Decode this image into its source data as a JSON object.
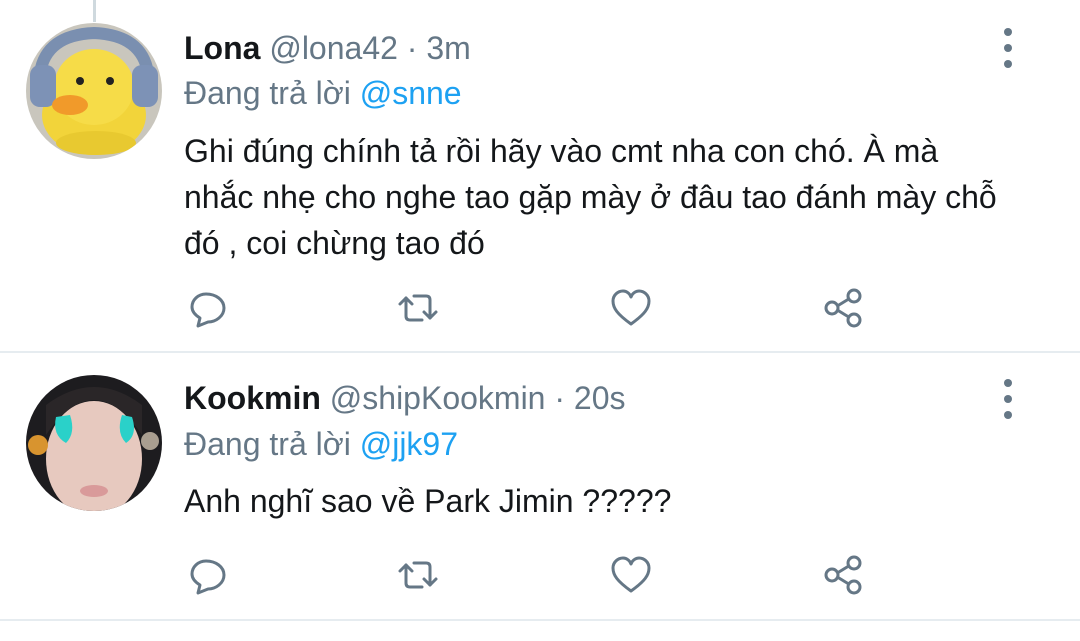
{
  "tweets": [
    {
      "name": "Lona",
      "handle": "@lona42",
      "separator": "·",
      "time": "3m",
      "reply_prefix": "Đang trả lời",
      "reply_to": "@snne",
      "text": "Ghi đúng chính tả rồi hãy vào cmt nha con chó. À mà nhắc nhẹ cho nghe tao gặp mày ở đâu tao đánh mày chỗ đó , coi chừng tao đó",
      "avatar_icon": "yellow-duck-with-headphones-avatar"
    },
    {
      "name": "Kookmin",
      "handle": "@shipKookmin",
      "separator": "·",
      "time": "20s",
      "reply_prefix": "Đang trả lời",
      "reply_to": "@jjk97",
      "text": "Anh nghĩ sao về Park Jimin ?????",
      "avatar_icon": "crying-face-photo-avatar"
    }
  ],
  "action_icons": [
    "reply-icon",
    "retweet-icon",
    "like-icon",
    "share-icon"
  ],
  "colors": {
    "text": "#14171a",
    "secondary": "#657786",
    "link": "#1da1f2",
    "divider": "#e6ecf0"
  }
}
